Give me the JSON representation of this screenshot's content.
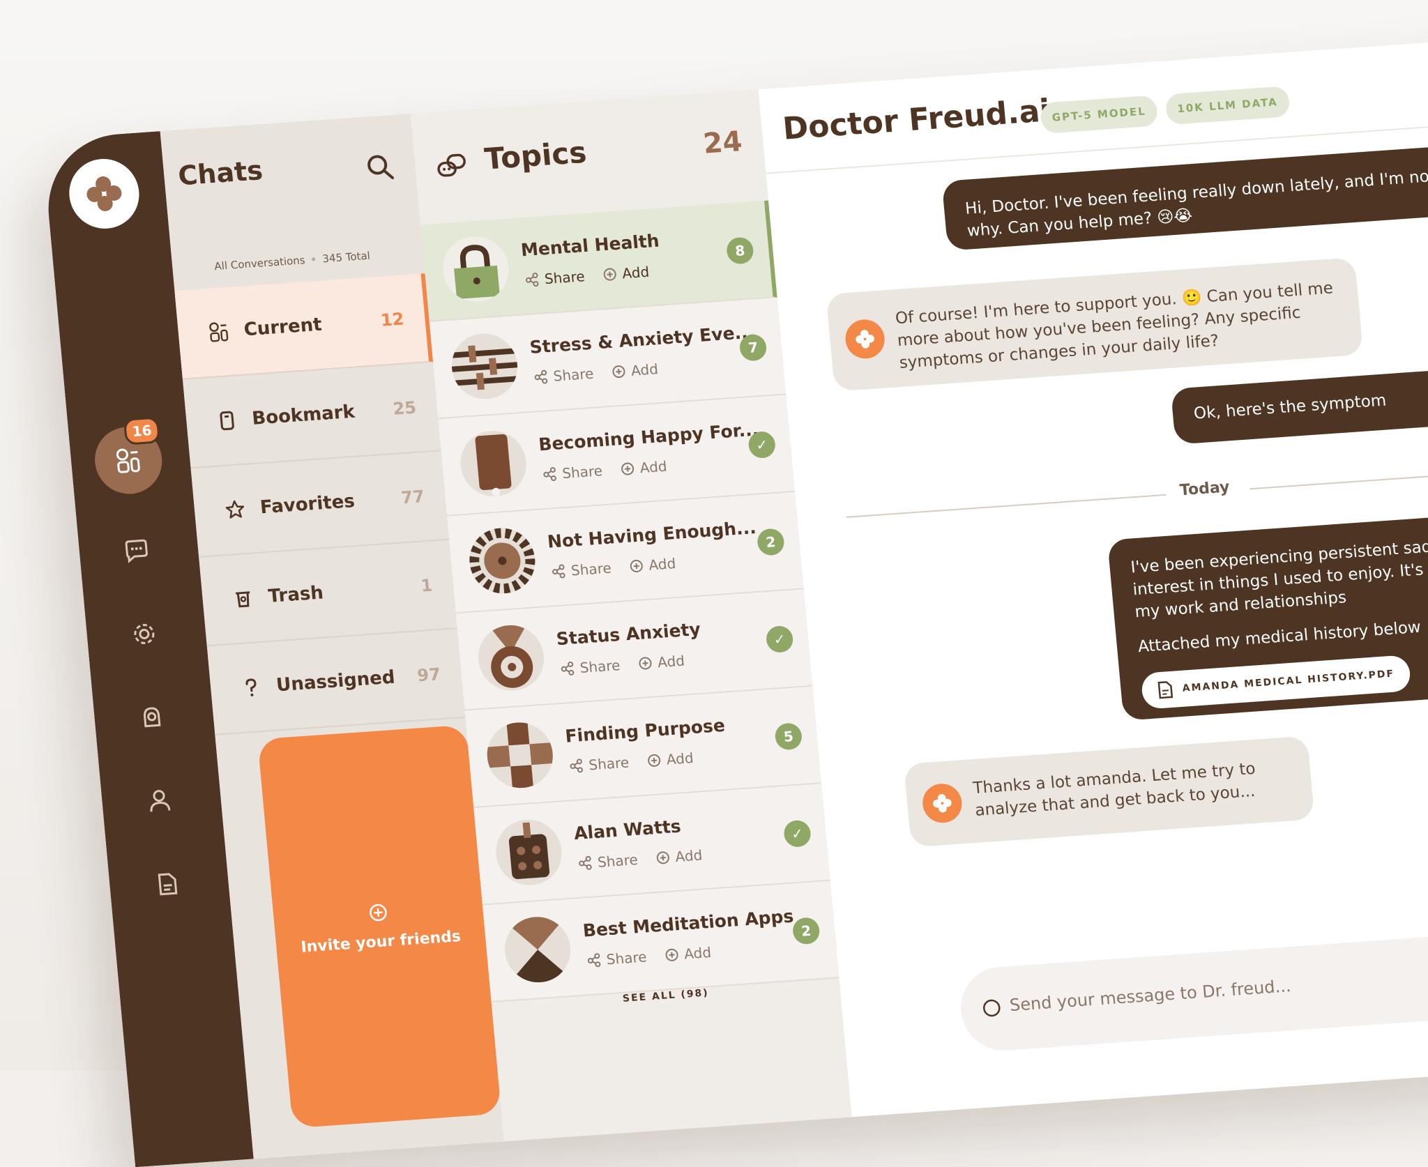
{
  "rail": {
    "badge": "16",
    "items": [
      "people-icon",
      "chat-icon",
      "gear-icon",
      "brain-icon",
      "user-icon",
      "document-icon"
    ]
  },
  "chats": {
    "title": "Chats",
    "sub_label": "All Conversations",
    "sub_total": "345 Total",
    "menu": [
      {
        "label": "Current",
        "count": "12",
        "icon": "people-icon"
      },
      {
        "label": "Bookmark",
        "count": "25",
        "icon": "bookmark-icon"
      },
      {
        "label": "Favorites",
        "count": "77",
        "icon": "star-icon"
      },
      {
        "label": "Trash",
        "count": "1",
        "icon": "trash-icon"
      },
      {
        "label": "Unassigned",
        "count": "97",
        "icon": "question-icon"
      }
    ],
    "invite_label": "Invite your friends"
  },
  "topics": {
    "title": "Topics",
    "count": "24",
    "share_label": "Share",
    "add_label": "Add",
    "items": [
      {
        "title": "Mental Health",
        "badge": "8"
      },
      {
        "title": "Stress & Anxiety Eve...",
        "badge": "7"
      },
      {
        "title": "Becoming Happy For...",
        "badge": "✓"
      },
      {
        "title": "Not Having Enough...",
        "badge": "2"
      },
      {
        "title": "Status Anxiety",
        "badge": "✓"
      },
      {
        "title": "Finding Purpose",
        "badge": "5"
      },
      {
        "title": "Alan Watts",
        "badge": "✓"
      },
      {
        "title": "Best Meditation Apps",
        "badge": "2"
      }
    ],
    "see_all": "SEE ALL (98)"
  },
  "main": {
    "title": "Doctor Freud.ai",
    "tags": [
      "GPT-5 MODEL",
      "10K LLM DATA"
    ],
    "messages": {
      "m1": "Hi, Doctor. I've been feeling really down lately, and I'm not su why. Can you help me? 😢😭",
      "m2": "Of course! I'm here to support you. 🙂 Can you tell me more about how you've been feeling? Any specific symptoms or changes in your daily life?",
      "m3": "Ok, here's the symptom",
      "m4": "I've been experiencing persistent sad of interest in things I used to enjoy. It's affecting my work and relationships",
      "m4b": "Attached my medical history below",
      "attachment": "AMANDA MEDICAL HISTORY.PDF",
      "m5": "Thanks a lot amanda. Let me try to analyze that and get back to you..."
    },
    "today": "Today",
    "input_placeholder": "Send your message to Dr. freud..."
  },
  "colors": {
    "brown": "#4e3422",
    "orange": "#f38847",
    "green": "#8fa866"
  }
}
